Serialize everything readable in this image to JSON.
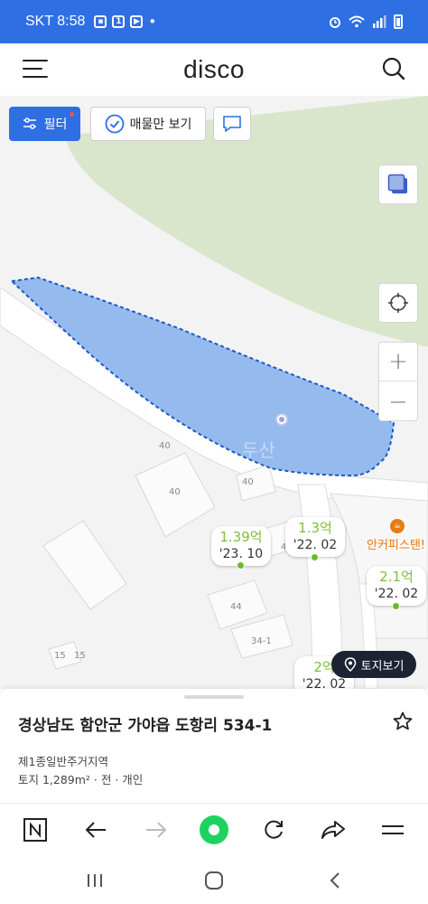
{
  "status_bar": {
    "time": "SKT 8:58",
    "badge": "1"
  },
  "header": {
    "title": "disco"
  },
  "map": {
    "chips": {
      "filter": "필터",
      "only_listings": "매물만 보기"
    },
    "watermark": "두산",
    "building_labels": [
      "40",
      "40",
      "40",
      "40",
      "44",
      "34-1",
      "15",
      "15"
    ],
    "markers": [
      {
        "price": "1.39억",
        "date": "'23. 10"
      },
      {
        "price": "1.3억",
        "date": "'22. 02"
      },
      {
        "price": "2.1억",
        "date": "'22. 02"
      },
      {
        "price": "2억",
        "date": "'22. 02"
      }
    ],
    "poi": "안커피스탠!",
    "land_view_button": "토지보기",
    "colors": {
      "parcel_fill": "#8fb6ec",
      "parcel_border": "#1d59c6",
      "green_area": "#d9e6cc",
      "price_green": "#7cc03a"
    }
  },
  "sheet": {
    "address": "경상남도 함안군 가야읍 도항리 534-1",
    "zone": "제1종일반주거지역",
    "land_info": "토지 1,289m² · 전 · 개인"
  }
}
